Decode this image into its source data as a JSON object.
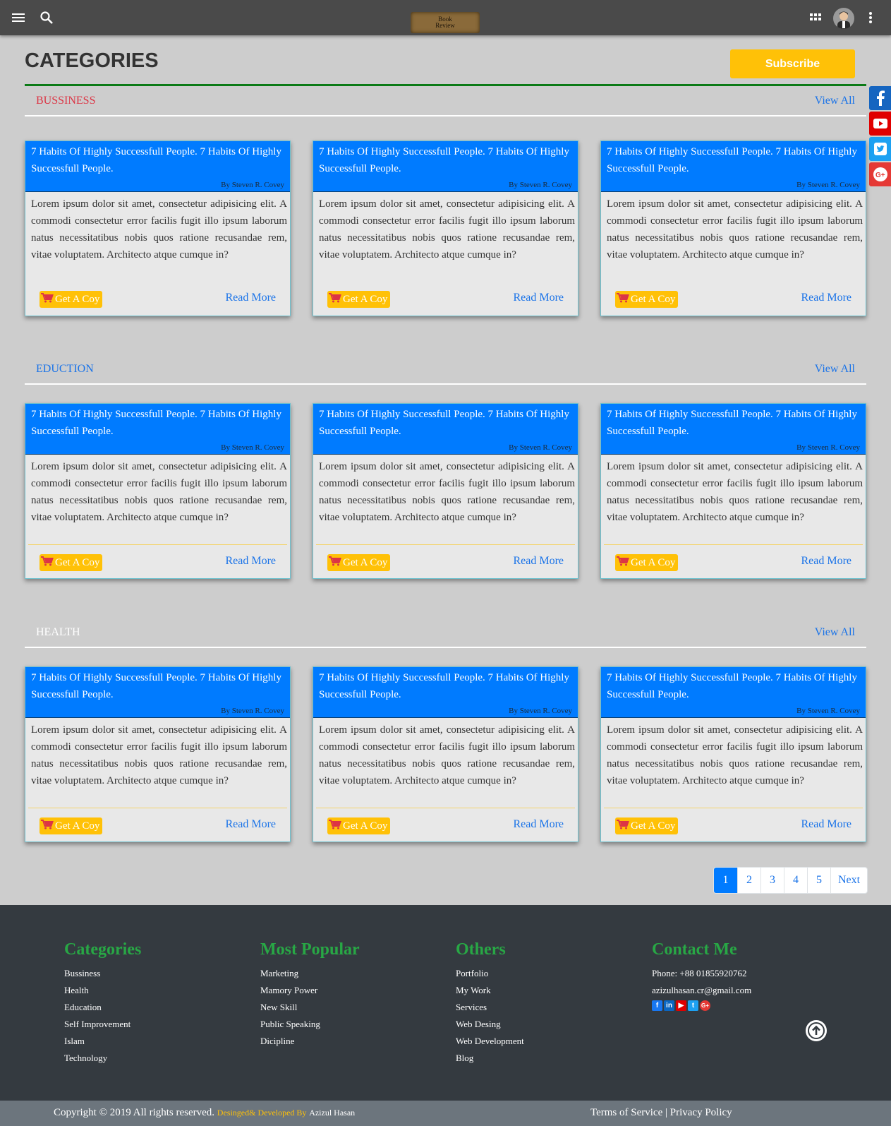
{
  "topbar": {
    "logo_line1": "Book",
    "logo_line2": "Review",
    "icons": [
      "menu-icon",
      "search-icon",
      "apps-grid-icon",
      "avatar",
      "more-vert-icon"
    ]
  },
  "header": {
    "title": "CATEGORIES",
    "subscribe_label": "Subscribe"
  },
  "social": [
    "facebook",
    "youtube",
    "twitter",
    "google-plus"
  ],
  "colors": {
    "primary": "#007bff",
    "accent": "#ffc107",
    "green": "#28a745",
    "bussiness": "#dc3545",
    "eduction": "#1a73e8",
    "health": "#ffffff"
  },
  "view_all_label": "View All",
  "card": {
    "title": "7 Habits Of Highly Successfull People. 7 Habits Of Highly Successfull People.",
    "author": "By Steven R. Covey",
    "body": "Lorem ipsum dolor sit amet, consectetur adipisicing elit. A commodi consectetur error facilis fugit illo ipsum laborum natus necessitatibus nobis quos ratione recusandae rem, vitae voluptatem. Architecto atque cumque in?",
    "copy_label": "Get A Coy",
    "read_more_label": "Read More"
  },
  "sections": [
    {
      "name": "BUSSINESS"
    },
    {
      "name": "EDUCTION"
    },
    {
      "name": "HEALTH"
    }
  ],
  "pagination": {
    "pages": [
      "1",
      "2",
      "3",
      "4",
      "5"
    ],
    "active": "1",
    "next_label": "Next"
  },
  "footer": {
    "categories": {
      "title": "Categories",
      "items": [
        "Bussiness",
        "Health",
        "Education",
        "Self Improvement",
        "Islam",
        "Technology"
      ]
    },
    "popular": {
      "title": "Most Popular",
      "items": [
        "Marketing",
        "Mamory Power",
        "New Skill",
        "Public Speaking",
        "Dicipline"
      ]
    },
    "others": {
      "title": "Others",
      "items": [
        "Portfolio",
        "My Work",
        "Services",
        "Web Desing",
        "Web Development",
        "Blog"
      ]
    },
    "contact": {
      "title": "Contact Me",
      "phone": "Phone: +88 01855920762",
      "email": "azizulhasan.cr@gmail.com",
      "icons": [
        "facebook-icon",
        "linkedin-icon",
        "youtube-icon",
        "twitter-icon",
        "google-plus-icon"
      ]
    }
  },
  "bottombar": {
    "copyright": "Copyright © 2019 All rights reserved.",
    "developed": "Desinged& Developed By",
    "developer": "Azizul Hasan",
    "terms": "Terms of Service",
    "separator": "|",
    "privacy": "Privacy Policy"
  }
}
